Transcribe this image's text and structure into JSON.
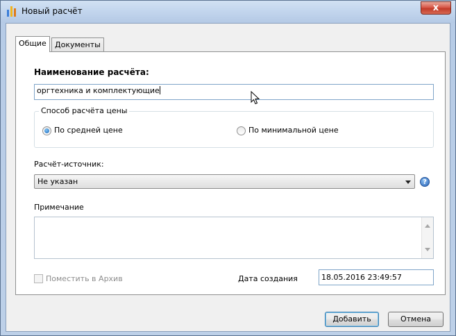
{
  "window": {
    "title": "Новый расчёт",
    "close_label": "x"
  },
  "tabs": [
    {
      "label": "Общие",
      "active": true
    },
    {
      "label": "Документы",
      "active": false
    }
  ],
  "form": {
    "name_label": "Наименование расчёта:",
    "name_value": "оргтехника и комплектующие",
    "price_group": {
      "legend": "Способ расчёта цены",
      "options": [
        {
          "label": "По средней цене",
          "checked": true
        },
        {
          "label": "По минимальной цене",
          "checked": false
        }
      ]
    },
    "source_label": "Расчёт-источник:",
    "source_value": "Не указан",
    "help_glyph": "?",
    "note_label": "Примечание",
    "note_value": "",
    "archive_label": "Поместить в Архив",
    "archive_checked": false,
    "created_label": "Дата создания",
    "created_value": "18.05.2016 23:49:57"
  },
  "buttons": {
    "add": "Добавить",
    "cancel": "Отмена"
  },
  "colors": {
    "title_bar": "#c2d5ed",
    "close_button": "#c23c2a",
    "selection_accent": "#1a67b6"
  }
}
